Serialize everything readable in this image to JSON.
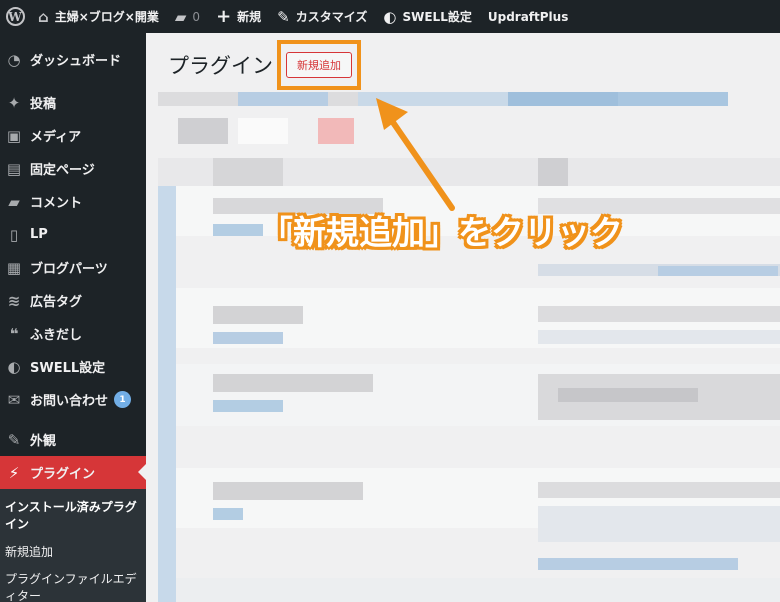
{
  "adminbar": {
    "wp_icon": "wordpress-icon",
    "site_name": "主婦×ブログ×開業",
    "comments_count": "0",
    "new_label": "新規",
    "customize_label": "カスタマイズ",
    "swell_label": "SWELL設定",
    "updraft_label": "UpdraftPlus"
  },
  "sidebar": {
    "items": [
      {
        "label": "ダッシュボード",
        "icon": "dashboard-icon"
      },
      {
        "label": "投稿",
        "icon": "pin-icon"
      },
      {
        "label": "メディア",
        "icon": "media-icon"
      },
      {
        "label": "固定ページ",
        "icon": "page-icon"
      },
      {
        "label": "コメント",
        "icon": "comment-icon"
      },
      {
        "label": "LP",
        "icon": "document-icon"
      },
      {
        "label": "ブログパーツ",
        "icon": "grid-icon"
      },
      {
        "label": "広告タグ",
        "icon": "ad-icon"
      },
      {
        "label": "ふきだし",
        "icon": "speech-bubble-icon"
      },
      {
        "label": "SWELL設定",
        "icon": "swell-icon"
      },
      {
        "label": "お問い合わせ",
        "icon": "mail-icon",
        "badge": "1"
      },
      {
        "label": "外観",
        "icon": "brush-icon"
      },
      {
        "label": "プラグイン",
        "icon": "plugin-icon"
      }
    ],
    "submenu": [
      {
        "label": "インストール済みプラグイン"
      },
      {
        "label": "新規追加"
      },
      {
        "label": "プラグインファイルエディター"
      }
    ]
  },
  "main": {
    "title": "プラグイン",
    "add_new_label": "新規追加"
  },
  "annotation": {
    "callout": "「新規追加」をクリック"
  },
  "colors": {
    "adminbar_bg": "#1d2327",
    "active_menu": "#d63638",
    "highlight": "#f0921b",
    "page_bg": "#f0f0f1"
  }
}
